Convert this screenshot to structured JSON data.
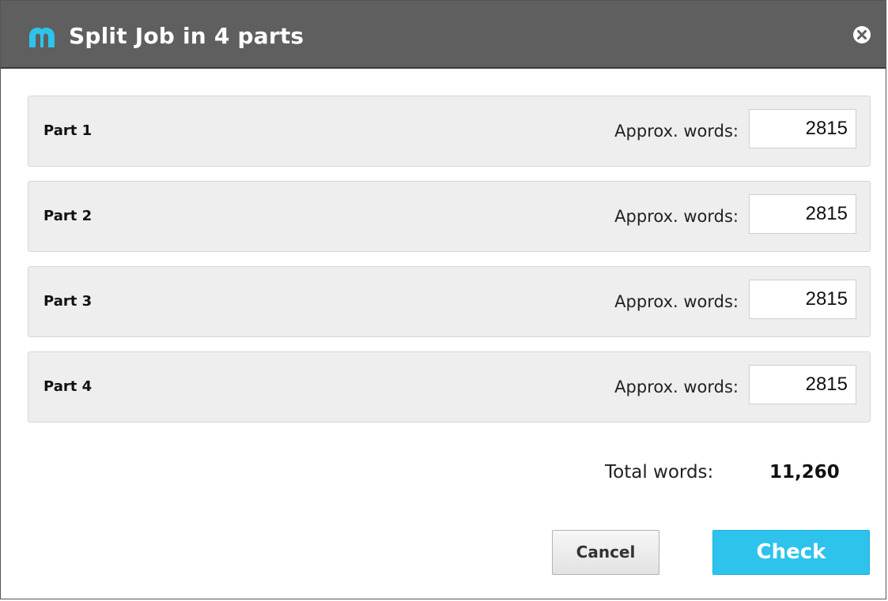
{
  "dialog": {
    "title": "Split Job in 4 parts",
    "accent_color": "#2ec3ec",
    "titlebar_color": "#5f5f5f",
    "logo_icon": "memsource-logo-icon",
    "close_icon": "close-circle-icon"
  },
  "parts": [
    {
      "label": "Part 1",
      "approx_label": "Approx. words:",
      "words": "2815"
    },
    {
      "label": "Part 2",
      "approx_label": "Approx. words:",
      "words": "2815"
    },
    {
      "label": "Part 3",
      "approx_label": "Approx. words:",
      "words": "2815"
    },
    {
      "label": "Part 4",
      "approx_label": "Approx. words:",
      "words": "2815"
    }
  ],
  "total": {
    "label": "Total words:",
    "value": "11,260"
  },
  "buttons": {
    "cancel": "Cancel",
    "check": "Check"
  }
}
